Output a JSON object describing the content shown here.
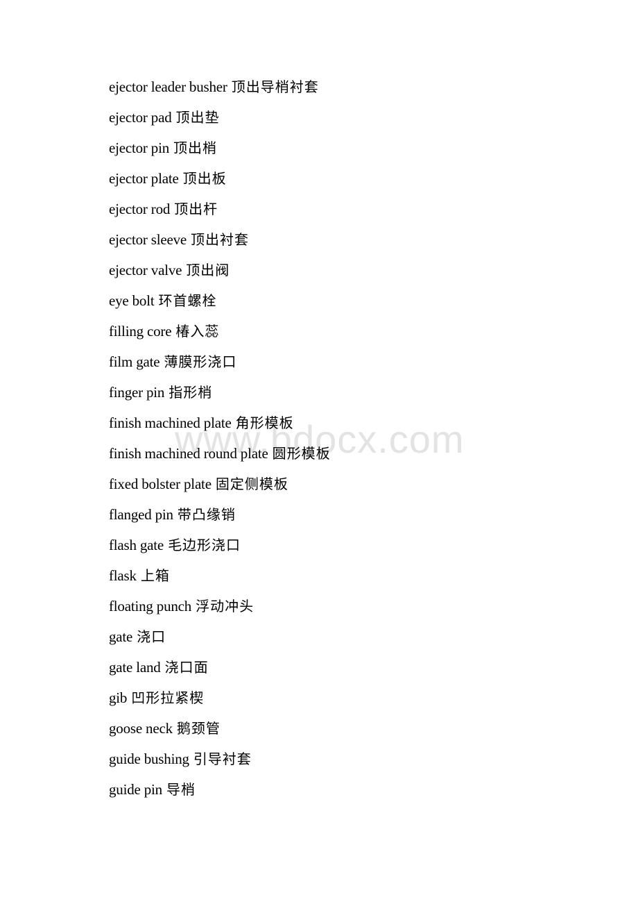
{
  "watermark": "www.bdocx.com",
  "entries": [
    {
      "term": "ejector leader busher",
      "translation": "顶出导梢衬套"
    },
    {
      "term": "ejector pad",
      "translation": "顶出垫"
    },
    {
      "term": "ejector pin",
      "translation": "顶出梢"
    },
    {
      "term": "ejector plate",
      "translation": "顶出板"
    },
    {
      "term": "ejector rod",
      "translation": "顶出杆"
    },
    {
      "term": "ejector sleeve",
      "translation": "顶出衬套"
    },
    {
      "term": "ejector valve",
      "translation": "顶出阀"
    },
    {
      "term": "eye bolt",
      "translation": "环首螺栓"
    },
    {
      "term": "filling core",
      "translation": "椿入蕊"
    },
    {
      "term": "film gate",
      "translation": "薄膜形浇口"
    },
    {
      "term": "finger pin",
      "translation": "指形梢"
    },
    {
      "term": "finish machined plate",
      "translation": "角形模板"
    },
    {
      "term": "finish machined round plate",
      "translation": "圆形模板"
    },
    {
      "term": "fixed bolster plate",
      "translation": "固定侧模板"
    },
    {
      "term": "flanged pin",
      "translation": "带凸缘销"
    },
    {
      "term": "flash gate",
      "translation": "毛边形浇口"
    },
    {
      "term": "flask",
      "translation": "上箱"
    },
    {
      "term": "floating punch",
      "translation": "浮动冲头"
    },
    {
      "term": "gate",
      "translation": "浇口"
    },
    {
      "term": "gate land",
      "translation": "浇口面"
    },
    {
      "term": "gib",
      "translation": "凹形拉紧楔"
    },
    {
      "term": "goose neck",
      "translation": "鹅颈管"
    },
    {
      "term": "guide bushing",
      "translation": "引导衬套"
    },
    {
      "term": "guide pin",
      "translation": "导梢"
    }
  ]
}
